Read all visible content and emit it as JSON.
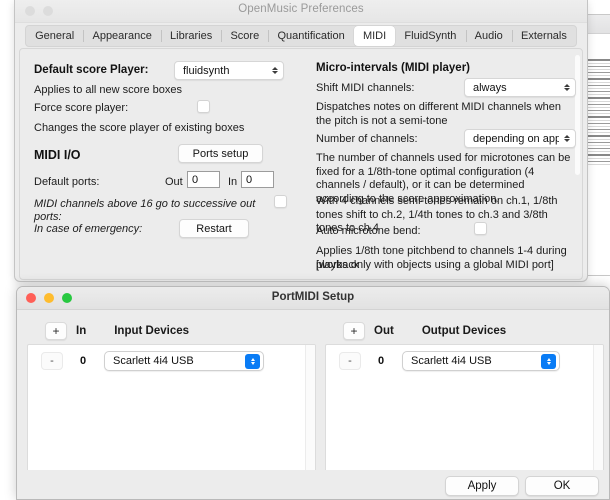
{
  "background_windows": {
    "score_window_label": "score-editor-background"
  },
  "preferences_window": {
    "title": "OpenMusic Preferences",
    "traffic_lights": [
      "close",
      "minimize"
    ],
    "tabs": [
      {
        "label": "General",
        "selected": false
      },
      {
        "label": "Appearance",
        "selected": false
      },
      {
        "label": "Libraries",
        "selected": false
      },
      {
        "label": "Score",
        "selected": false
      },
      {
        "label": "Quantification",
        "selected": false
      },
      {
        "label": "MIDI",
        "selected": true
      },
      {
        "label": "FluidSynth",
        "selected": false
      },
      {
        "label": "Audio",
        "selected": false
      },
      {
        "label": "Externals",
        "selected": false
      }
    ],
    "left_column": {
      "default_player_label": "Default score Player:",
      "default_player_value": "fluidsynth",
      "default_player_hint": "Applies to all new score boxes",
      "force_player_label": "Force score player:",
      "force_player_checked": false,
      "force_player_hint": "Changes the score player of existing boxes",
      "midi_io_heading": "MIDI I/O",
      "ports_setup_button": "Ports setup",
      "default_ports_label": "Default ports:",
      "out_label": "Out",
      "out_value": "0",
      "in_label": "In",
      "in_value": "0",
      "successive_ports_label": "MIDI channels above 16 go to successive out ports:",
      "successive_ports_checked": false,
      "emergency_label": "In case of emergency:",
      "restart_button": "Restart"
    },
    "right_column": {
      "heading": "Micro-intervals (MIDI player)",
      "shift_channels_label": "Shift MIDI channels:",
      "shift_channels_value": "always",
      "shift_channels_hint": "Dispatches notes on different MIDI channels when the pitch is not a semi-tone",
      "num_channels_label": "Number of channels:",
      "num_channels_value": "depending on approx",
      "num_channels_hint_1": "The number of channels used for microtones can be fixed for a 1/8th-tone optimal configuration (4 channels / default), or it can be determined according to the score approximation.",
      "num_channels_hint_2": "With 4 channels  semi-tones remain on ch.1, 1/8th tones shift to ch.2, 1/4th tones to ch.3 and 3/8th tones to ch.4",
      "auto_bend_label": "Auto microtone bend:",
      "auto_bend_checked": false,
      "auto_bend_hint_1": "Applies 1/8th tone pitchbend to channels 1-4 during playback",
      "auto_bend_hint_2": "[works only with objects using a global MIDI port]"
    }
  },
  "portmidi_window": {
    "title": "PortMIDI Setup",
    "traffic_lights": [
      "close",
      "minimize",
      "zoom"
    ],
    "accent_color": "#0a7cf5",
    "input_pane": {
      "add_button": "+",
      "direction_label": "In",
      "devices_header": "Input Devices",
      "rows": [
        {
          "remove_button": "-",
          "index": "0",
          "device": "Scarlett 4i4 USB"
        }
      ]
    },
    "output_pane": {
      "add_button": "+",
      "direction_label": "Out",
      "devices_header": "Output Devices",
      "rows": [
        {
          "remove_button": "-",
          "index": "0",
          "device": "Scarlett 4i4 USB"
        }
      ]
    },
    "footer": {
      "apply_button": "Apply",
      "ok_button": "OK"
    }
  }
}
